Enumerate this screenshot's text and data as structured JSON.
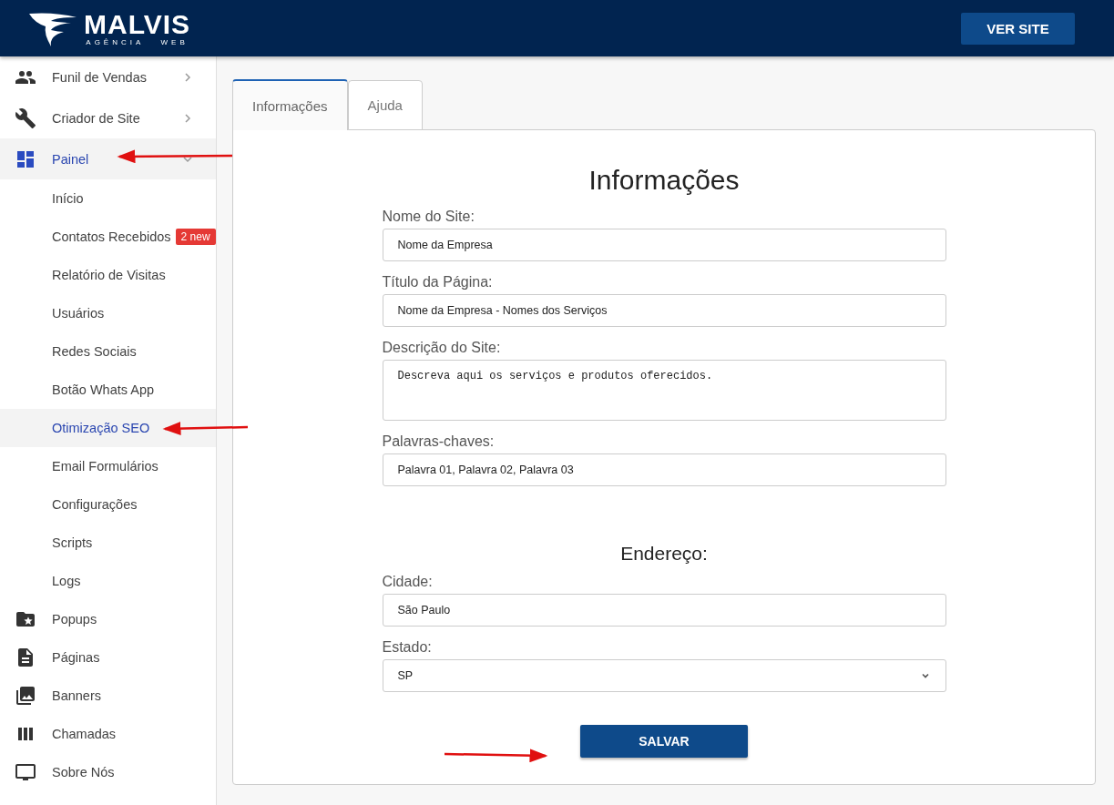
{
  "header": {
    "logo": {
      "name": "MALVIS",
      "tagline": "AGÊNCIA   WEB"
    },
    "button": "VER SITE"
  },
  "sidebar": {
    "items": [
      {
        "label": "Funil de Vendas",
        "selected": false,
        "expanded": false
      },
      {
        "label": "Criador de Site",
        "selected": false,
        "expanded": false
      },
      {
        "label": "Painel",
        "selected": true,
        "expanded": true,
        "children": [
          {
            "label": "Início",
            "selected": false
          },
          {
            "label": "Contatos Recebidos",
            "selected": false,
            "badge": "2 new"
          },
          {
            "label": "Relatório de Visitas",
            "selected": false
          },
          {
            "label": "Usuários",
            "selected": false
          },
          {
            "label": "Redes Sociais",
            "selected": false
          },
          {
            "label": "Botão Whats App",
            "selected": false
          },
          {
            "label": "Otimização SEO",
            "selected": true
          },
          {
            "label": "Email Formulários",
            "selected": false
          },
          {
            "label": "Configurações",
            "selected": false
          },
          {
            "label": "Scripts",
            "selected": false
          },
          {
            "label": "Logs",
            "selected": false
          }
        ]
      },
      {
        "label": "Popups",
        "selected": false
      },
      {
        "label": "Páginas",
        "selected": false
      },
      {
        "label": "Banners",
        "selected": false
      },
      {
        "label": "Chamadas",
        "selected": false
      },
      {
        "label": "Sobre Nós",
        "selected": false
      }
    ]
  },
  "tabs": [
    {
      "label": "Informações",
      "selected": true
    },
    {
      "label": "Ajuda",
      "selected": false
    }
  ],
  "form": {
    "title": "Informações",
    "fields": [
      {
        "kind": "text",
        "label": "Nome do Site:",
        "value": "Nome da Empresa"
      },
      {
        "kind": "text",
        "label": "Título da Página:",
        "value": "Nome da Empresa - Nomes dos Serviços"
      },
      {
        "kind": "textarea",
        "label": "Descrição do Site:",
        "value": "Descreva aqui os serviços e produtos oferecidos."
      },
      {
        "kind": "text",
        "label": "Palavras-chaves:",
        "value": "Palavra 01, Palavra 02, Palavra 03"
      }
    ],
    "address": {
      "title": "Endereço:",
      "fields": [
        {
          "kind": "text",
          "label": "Cidade:",
          "value": "São Paulo"
        },
        {
          "kind": "select",
          "label": "Estado:",
          "value": "SP"
        }
      ]
    },
    "button": "SALVAR"
  }
}
